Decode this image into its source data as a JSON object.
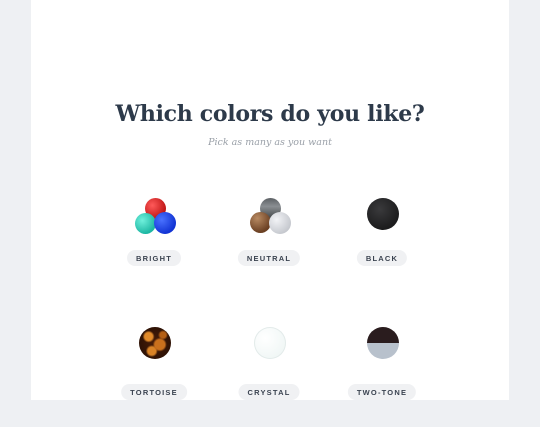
{
  "question": {
    "title": "Which colors do you like?",
    "subtitle": "Pick as many as you want"
  },
  "options": [
    {
      "label": "BRIGHT",
      "icon": "bright-swatch-icon"
    },
    {
      "label": "NEUTRAL",
      "icon": "neutral-swatch-icon"
    },
    {
      "label": "BLACK",
      "icon": "black-swatch-icon"
    },
    {
      "label": "TORTOISE",
      "icon": "tortoise-swatch-icon"
    },
    {
      "label": "CRYSTAL",
      "icon": "crystal-swatch-icon"
    },
    {
      "label": "TWO-TONE",
      "icon": "two-tone-swatch-icon"
    }
  ],
  "colors": {
    "background": "#eef0f3",
    "card": "#ffffff",
    "title": "#2d3a4a",
    "subtitle": "#9aa0a8",
    "pill": "#f0f1f3"
  }
}
